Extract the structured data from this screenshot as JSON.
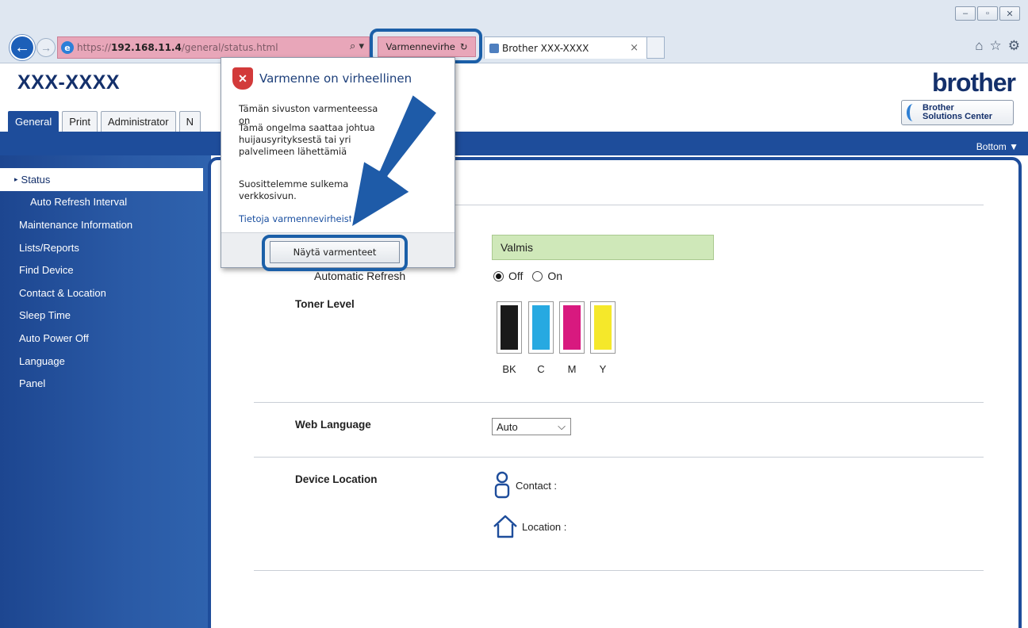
{
  "browser": {
    "address": {
      "protocol": "https://",
      "host": "192.168.11.4",
      "path": "/general/status.html"
    },
    "cert_error_label": "Varmennevirhe",
    "tab_title": "Brother  XXX-XXXX",
    "window_buttons": [
      "–",
      "▫",
      "✕"
    ]
  },
  "header": {
    "model": "XXX-XXXX",
    "brand": "brother",
    "solutions_center": {
      "line1": "Brother",
      "line2": "Solutions Center"
    },
    "tabs": [
      {
        "label": "General",
        "active": true
      },
      {
        "label": "Print"
      },
      {
        "label": "Administrator"
      },
      {
        "label": "N"
      }
    ],
    "bottom_link": "Bottom ▼"
  },
  "sidebar": {
    "items": [
      {
        "label": "Status",
        "active": true
      },
      {
        "label": "Auto Refresh Interval",
        "sub": true
      },
      {
        "label": "Maintenance Information"
      },
      {
        "label": "Lists/Reports"
      },
      {
        "label": "Find Device"
      },
      {
        "label": "Contact & Location"
      },
      {
        "label": "Sleep Time"
      },
      {
        "label": "Auto Power Off"
      },
      {
        "label": "Language"
      },
      {
        "label": "Panel"
      }
    ]
  },
  "content": {
    "status_value": "Valmis",
    "auto_refresh_label": "Automatic Refresh",
    "radio_off": "Off",
    "radio_on": "On",
    "toner_label": "Toner Level",
    "toner": [
      {
        "label": "BK",
        "color": "#1a1a1a"
      },
      {
        "label": "C",
        "color": "#27a9e1"
      },
      {
        "label": "M",
        "color": "#d8197f"
      },
      {
        "label": "Y",
        "color": "#f5e82a"
      }
    ],
    "web_language_label": "Web Language",
    "web_language_value": "Auto",
    "device_location_label": "Device Location",
    "contact_label": "Contact :",
    "location_label": "Location :"
  },
  "popup": {
    "title": "Varmenne on virheellinen",
    "p1": "Tämän sivuston varmenteessa on",
    "p2_line1": "Tämä ongelma saattaa johtua",
    "p2_line2": "huijausyrityksestä tai yri",
    "p2_line3": "palvelimeen lähettämiä",
    "p3_line1": "Suosittelemme sulkema",
    "p3_line2": "verkkosivun.",
    "link": "Tietoja varmennevirheist",
    "button": "Näytä varmenteet"
  }
}
